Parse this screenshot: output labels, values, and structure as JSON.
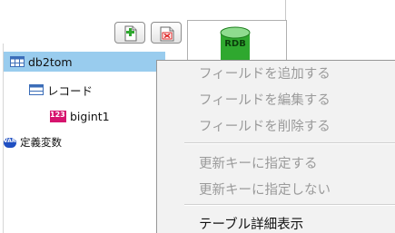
{
  "toolbar": {
    "add_icon": "add-file-icon",
    "delete_icon": "delete-file-icon"
  },
  "db_icon": {
    "name": "database-icon",
    "label": "RDB",
    "color": "#2fa82f"
  },
  "tree": {
    "root": {
      "label": "db2tom",
      "icon": "table-icon"
    },
    "record": {
      "label": "レコード",
      "icon": "record-icon"
    },
    "column": {
      "label": "bigint1",
      "icon_text": "123",
      "icon_color": "#d6146e"
    },
    "variables": {
      "label": "定義変数",
      "icon_text": "VAR",
      "icon_color": "#1f4fc2"
    },
    "selected_color": "#99ccee"
  },
  "context_menu": {
    "items": [
      {
        "label": "フィールドを追加する",
        "enabled": false
      },
      {
        "label": "フィールドを編集する",
        "enabled": false
      },
      {
        "label": "フィールドを削除する",
        "enabled": false
      },
      {
        "label": "更新キーに指定する",
        "enabled": false
      },
      {
        "label": "更新キーに指定しない",
        "enabled": false
      },
      {
        "label": "テーブル詳細表示",
        "enabled": true
      }
    ]
  }
}
